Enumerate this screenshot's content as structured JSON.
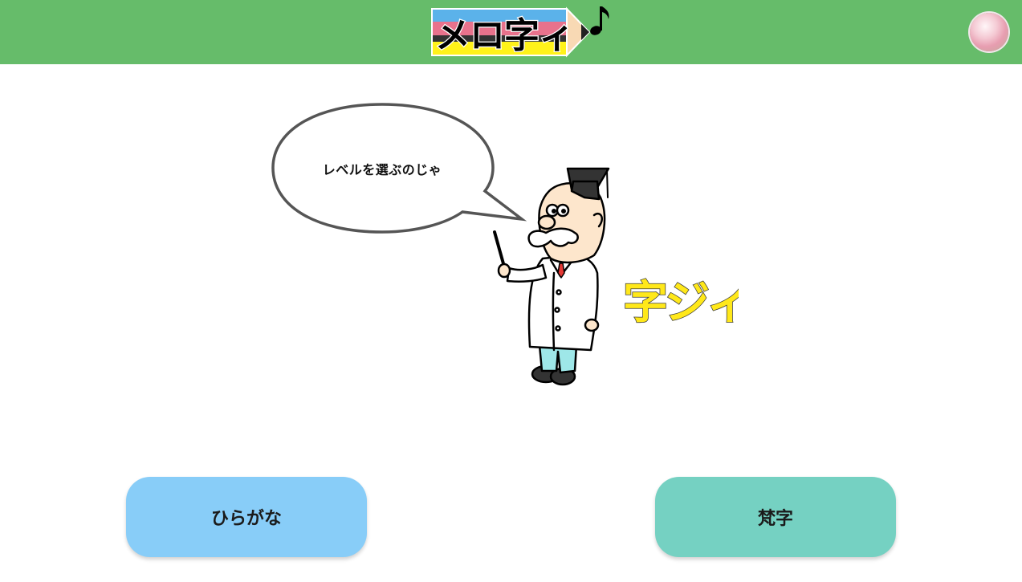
{
  "header": {
    "logo_text": "メロ字ィ",
    "logo_note_icon": "music-note-icon",
    "avatar_icon": "user-avatar",
    "background_color": "#66bc6a"
  },
  "main": {
    "speech_bubble_text": "レベルを選ぶのじゃ",
    "mascot_icon": "professor-mascot",
    "mascot_name_text": "字ジィ"
  },
  "levels": [
    {
      "label": "ひらがな",
      "color": "#88cdf8"
    },
    {
      "label": "梵字",
      "color": "#75d1c2"
    }
  ]
}
